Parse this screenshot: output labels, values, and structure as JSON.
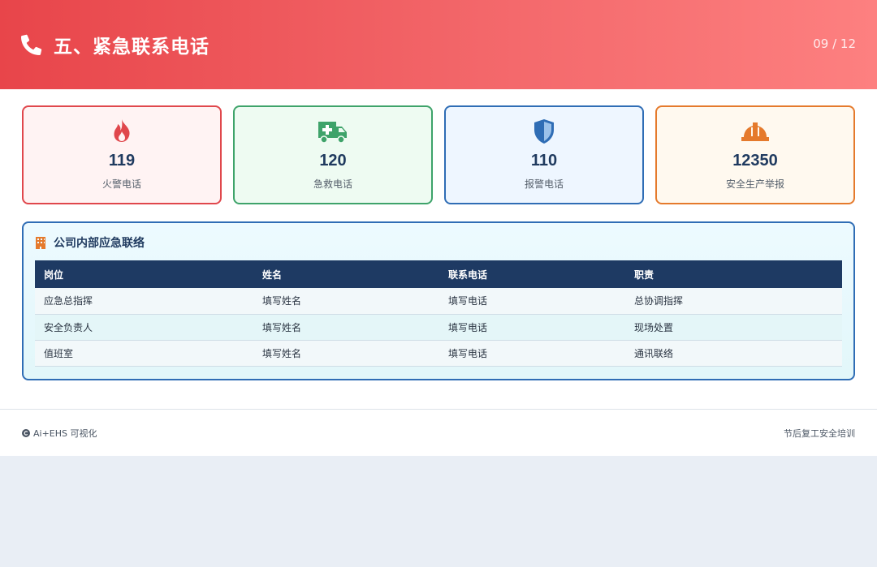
{
  "header": {
    "title": "五、紧急联系电话",
    "page": "09 / 12"
  },
  "cards": [
    {
      "number": "119",
      "label": "火警电话",
      "icon": "fire-icon"
    },
    {
      "number": "120",
      "label": "急救电话",
      "icon": "ambulance-icon"
    },
    {
      "number": "110",
      "label": "报警电话",
      "icon": "shield-icon"
    },
    {
      "number": "12350",
      "label": "安全生产举报",
      "icon": "hard-hat-icon"
    }
  ],
  "panel": {
    "title": "公司内部应急联络",
    "columns": [
      "岗位",
      "姓名",
      "联系电话",
      "职责"
    ],
    "rows": [
      [
        "应急总指挥",
        "填写姓名",
        "填写电话",
        "总协调指挥"
      ],
      [
        "安全负责人",
        "填写姓名",
        "填写电话",
        "现场处置"
      ],
      [
        "值班室",
        "填写姓名",
        "填写电话",
        "通讯联络"
      ]
    ]
  },
  "footer": {
    "brand": "Ai+EHS 可视化",
    "course": "节后复工安全培训"
  },
  "colors": {
    "header_start": "#e8454a",
    "header_end": "#fd8080",
    "red": "#e0474c",
    "green": "#3ea36a",
    "blue": "#2f6db5",
    "orange": "#e57a2c",
    "navy": "#1e3a63"
  }
}
